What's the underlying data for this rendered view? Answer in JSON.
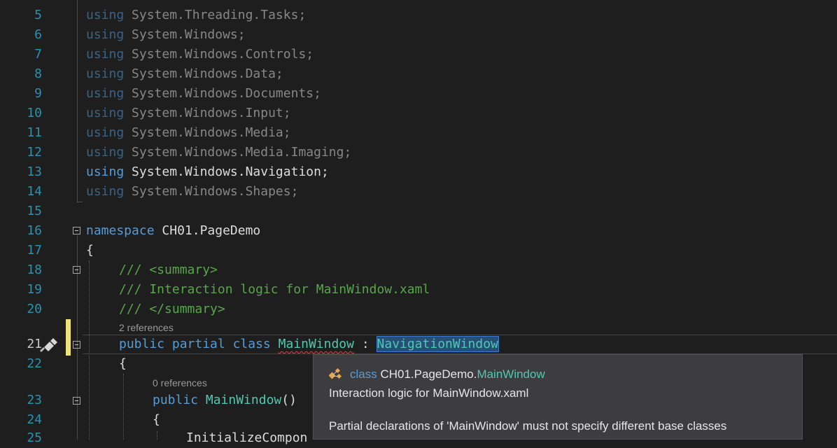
{
  "editor": {
    "using_keyword": "using",
    "lines": [
      {
        "number": "5",
        "ns": "System.Threading.Tasks;"
      },
      {
        "number": "6",
        "ns": "System.Windows;"
      },
      {
        "number": "7",
        "ns": "System.Windows.Controls;"
      },
      {
        "number": "8",
        "ns": "System.Windows.Data;"
      },
      {
        "number": "9",
        "ns": "System.Windows.Documents;"
      },
      {
        "number": "10",
        "ns": "System.Windows.Input;"
      },
      {
        "number": "11",
        "ns": "System.Windows.Media;"
      },
      {
        "number": "12",
        "ns": "System.Windows.Media.Imaging;"
      },
      {
        "number": "13",
        "ns": "System.Windows.Navigation;"
      },
      {
        "number": "14",
        "ns": "System.Windows.Shapes;"
      }
    ],
    "line_numbers": {
      "l15": "15",
      "l16": "16",
      "l17": "17",
      "l18": "18",
      "l19": "19",
      "l20": "20",
      "l21": "21",
      "l22": "22",
      "l23": "23",
      "l24": "24",
      "l25": "25"
    },
    "namespace_kw": "namespace",
    "namespace_name": "CH01.PageDemo",
    "open_brace": "{",
    "summary_open": "/// <summary>",
    "summary_text": "/// Interaction logic for MainWindow.xaml",
    "summary_close": "/// </summary>",
    "class_refs": "2 references",
    "class_kw_public": "public",
    "class_kw_partial": "partial",
    "class_kw_class": "class",
    "class_name": "MainWindow",
    "colon": ":",
    "base_class": "NavigationWindow",
    "class_open_brace": "{",
    "ctor_refs": "0 references",
    "ctor_public": "public",
    "ctor_name": "MainWindow",
    "ctor_parens": "()",
    "ctor_open_brace": "{",
    "partial_call": "InitializeCompon"
  },
  "tooltip": {
    "kind": "class",
    "namespace": "CH01.PageDemo.",
    "class_name": "MainWindow",
    "description": "Interaction logic for MainWindow.xaml",
    "error": "Partial declarations of 'MainWindow' must not specify different base classes"
  },
  "colors": {
    "keyword": "#569cd6",
    "type": "#4ec9b0",
    "comment": "#57a64a",
    "line_number": "#2b91af",
    "change_marker": "#efe27a",
    "background": "#1e1e1e"
  }
}
